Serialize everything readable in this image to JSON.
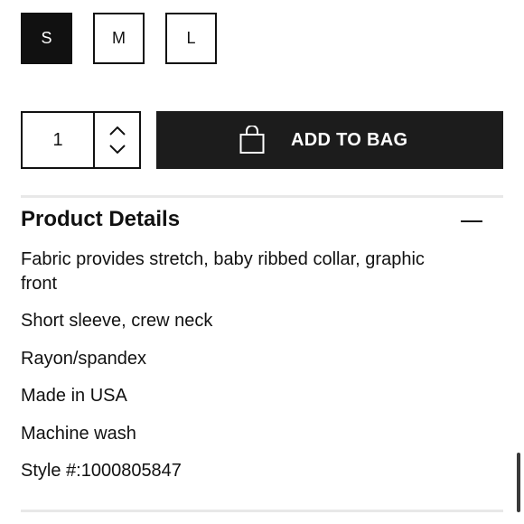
{
  "sizes": {
    "options": [
      "S",
      "M",
      "L"
    ],
    "selected": "S"
  },
  "quantity": {
    "value": "1"
  },
  "add_to_bag": {
    "label": "ADD TO BAG",
    "icon": "shopping-bag-icon"
  },
  "product_details": {
    "title": "Product Details",
    "toggle_icon": "minus-icon",
    "items": [
      "Fabric provides stretch, baby ribbed collar, graphic front",
      "Short sleeve, crew neck",
      "Rayon/spandex",
      "Made in USA",
      "Machine wash",
      "Style #:1000805847"
    ]
  },
  "colors": {
    "primary": "#111111",
    "button": "#1c1c1c",
    "divider": "#e8e8e8"
  }
}
